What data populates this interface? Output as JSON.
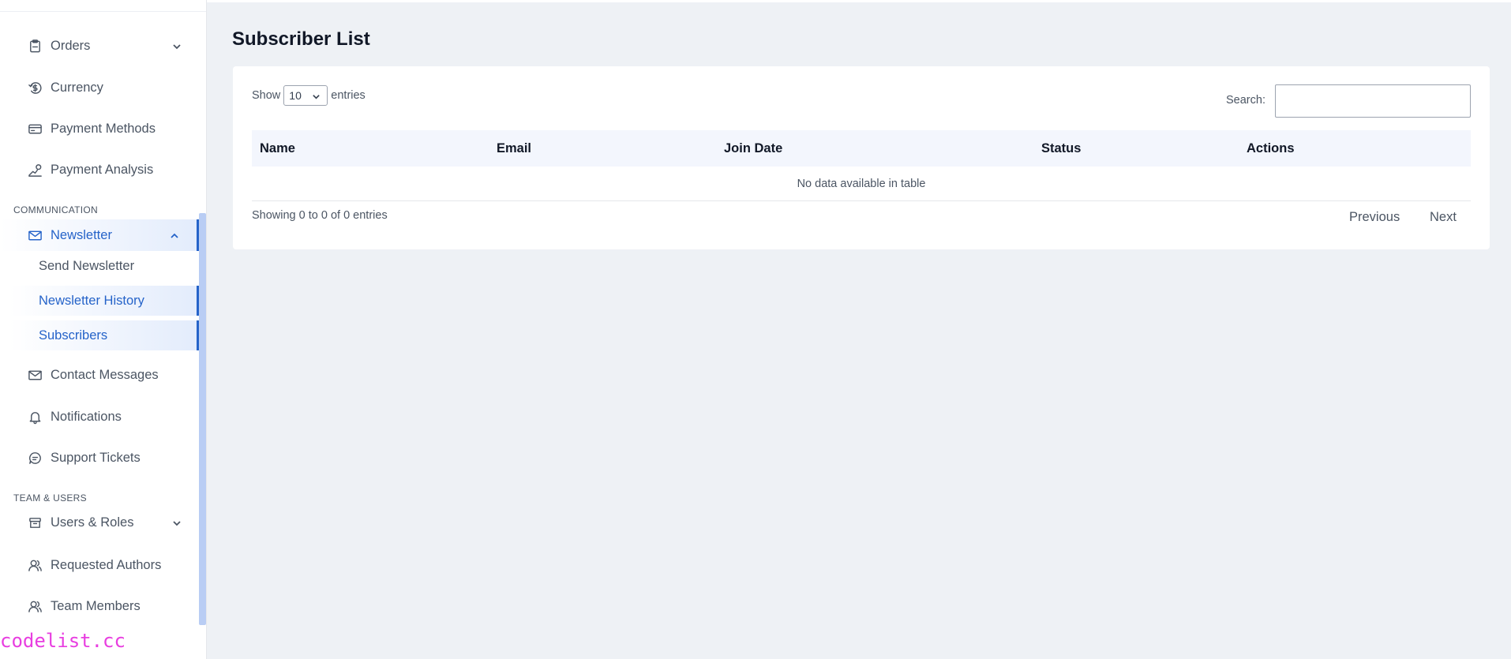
{
  "sidebar": {
    "items": [
      {
        "label": "Orders",
        "icon": "clipboard-icon"
      },
      {
        "label": "Currency",
        "icon": "currency-icon"
      },
      {
        "label": "Payment Methods",
        "icon": "credit-card-icon"
      },
      {
        "label": "Payment Analysis",
        "icon": "analysis-icon"
      }
    ],
    "section_communication": "COMMUNICATION",
    "newsletter": {
      "label": "Newsletter",
      "icon": "mail-icon",
      "children": [
        {
          "label": "Send Newsletter"
        },
        {
          "label": "Newsletter History"
        },
        {
          "label": "Subscribers"
        }
      ]
    },
    "comm_items": [
      {
        "label": "Contact Messages",
        "icon": "mail-icon"
      },
      {
        "label": "Notifications",
        "icon": "bell-icon"
      },
      {
        "label": "Support Tickets",
        "icon": "chat-icon"
      }
    ],
    "section_team": "TEAM & USERS",
    "team_items": [
      {
        "label": "Users & Roles",
        "icon": "box-icon"
      },
      {
        "label": "Requested Authors",
        "icon": "users-icon"
      },
      {
        "label": "Team Members",
        "icon": "users-icon"
      }
    ],
    "watermark": "codelist.cc"
  },
  "main": {
    "title": "Subscriber List",
    "show_label": "Show",
    "page_size": "10",
    "entries_label": "entries",
    "search_label": "Search:",
    "search_value": "",
    "columns": [
      "Name",
      "Email",
      "Join Date",
      "Status",
      "Actions"
    ],
    "empty_message": "No data available in table",
    "info": "Showing 0 to 0 of 0 entries",
    "prev_label": "Previous",
    "next_label": "Next"
  },
  "colors": {
    "accent": "#2563c9",
    "page_bg": "#eef1f5",
    "header_bg": "#f3f6fd"
  }
}
